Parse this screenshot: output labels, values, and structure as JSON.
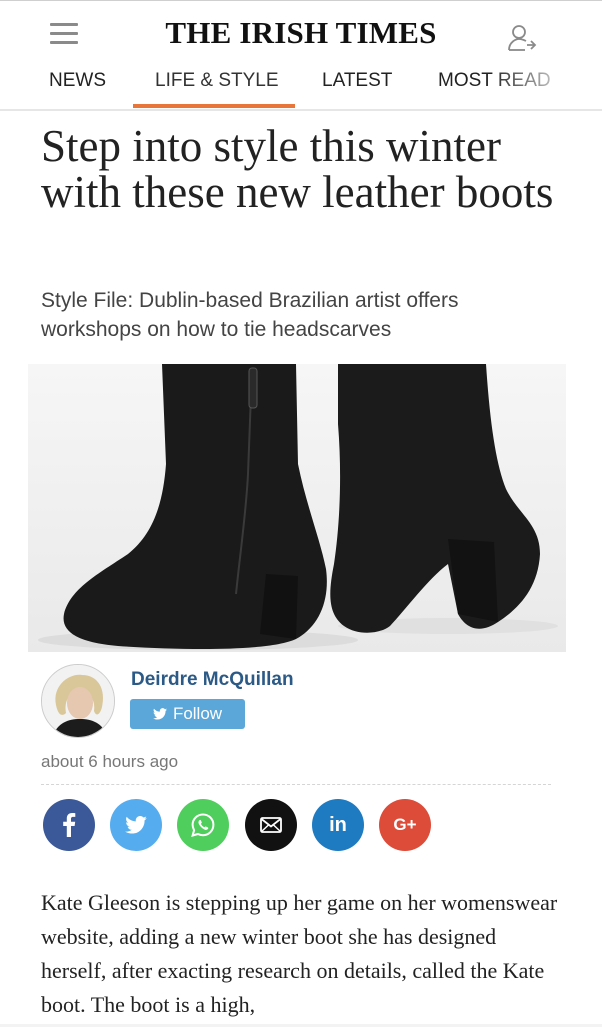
{
  "header": {
    "logo": "THE IRISH TIMES",
    "menu_icon": "hamburger-menu-icon",
    "account_icon": "user-account-icon"
  },
  "nav": {
    "items": [
      {
        "label": "NEWS",
        "active": false
      },
      {
        "label": "LIFE & STYLE",
        "active": true
      },
      {
        "label": "LATEST",
        "active": false
      },
      {
        "label": "MOST READ",
        "active": false
      }
    ],
    "accent": "#e8753a"
  },
  "article": {
    "headline": "Step into style this winter with these new leather boots",
    "standfirst": "Style File: Dublin-based Brazilian artist offers workshops on how to tie headscarves",
    "author": {
      "name": "Deirdre McQuillan",
      "follow_label": "Follow"
    },
    "timestamp": "about 6 hours ago",
    "body": "Kate Gleeson is stepping up her game on her womenswear website, adding a new winter boot she has designed herself, after exacting research on details, called the Kate boot. The boot is a high,"
  },
  "share": [
    {
      "name": "facebook",
      "label": "f",
      "color": "#3b5998"
    },
    {
      "name": "twitter",
      "label": "",
      "color": "#55acee"
    },
    {
      "name": "whatsapp",
      "label": "",
      "color": "#4fce5d"
    },
    {
      "name": "email",
      "label": "",
      "color": "#111111"
    },
    {
      "name": "linkedin",
      "label": "in",
      "color": "#1f7bc1"
    },
    {
      "name": "google-plus",
      "label": "G+",
      "color": "#dd4b39"
    }
  ],
  "colors": {
    "author_name": "#2b5a86",
    "follow_button": "#5ba7d9"
  }
}
